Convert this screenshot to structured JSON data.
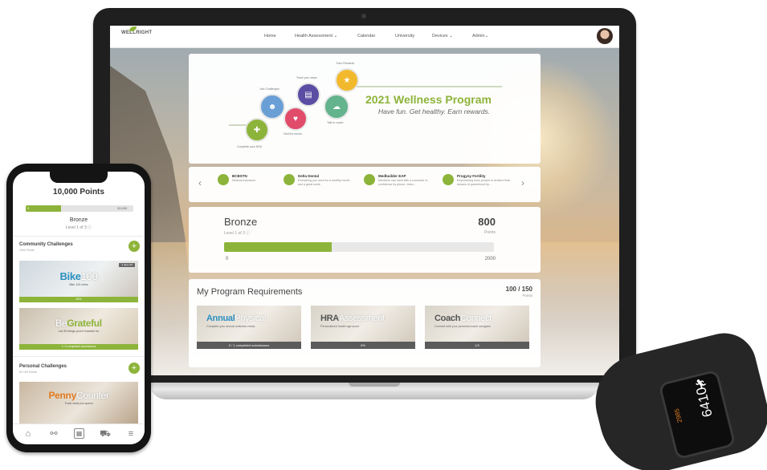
{
  "laptop": {
    "nav": {
      "logo": "WELLRIGHT",
      "items": [
        "Home",
        "Health Assessment ⌄",
        "Calendar",
        "University",
        "Devices ⌄",
        "Admin⌄"
      ]
    },
    "hero": {
      "title": "2021 Wellness Program",
      "subtitle": "Have fun. Get healthy. Earn rewards.",
      "steps": [
        "Complete your HRA",
        "Join Challenges",
        "Visit the doctor",
        "Track your steps",
        "Talk to coach",
        "Earn Rewards"
      ]
    },
    "partners": [
      {
        "name": "BCBSTN",
        "desc": "Medical Insurance"
      },
      {
        "name": "Delta Dental",
        "desc": "Everything you need for a healthy mouth and a great smile."
      },
      {
        "name": "Medbuilder EAP",
        "desc": "Members can meet with a counselor in confidence by phone, video..."
      },
      {
        "name": "Progyny Fertility",
        "desc": "Empowering more people to achieve their dreams of parenthood by..."
      }
    ],
    "level": {
      "name": "Bronze",
      "sub": "Level 1 of 3 ⓘ",
      "points": "800",
      "points_unit": "Points",
      "progress": 0.4,
      "min": "0",
      "max": "2000"
    },
    "requirements": {
      "title": "My Program Requirements",
      "count": "100 / 150",
      "unit": "Points",
      "tiles": [
        {
          "bold": "Annual",
          "light": "Physical",
          "desc": "Complete your annual wellness check.",
          "foot": "0 / 1 completed submissions"
        },
        {
          "bold": "HRA",
          "light": "Assessment",
          "desc": "Personalized health age score",
          "foot": "0%"
        },
        {
          "bold": "Coach",
          "light": "Connect",
          "desc": "Connect with your personal coach navigator",
          "foot": "1/3"
        }
      ]
    }
  },
  "phone": {
    "points_title": "10,000 Points",
    "bar_min": "0",
    "bar_max": "30,000",
    "progress": 0.33,
    "level": "Bronze",
    "level_sub": "Level 1 of 3 ⓘ",
    "community": {
      "title": "Community Challenges",
      "sub": "1000 Points",
      "plus": "+"
    },
    "personal": {
      "title": "Personal Challenges",
      "sub": "50-100 Points",
      "plus": "+"
    },
    "tiles": [
      {
        "bold": "Bike",
        "light": "100",
        "desc": "Bike 100 miles",
        "foot": "50%",
        "tag": "3 days left"
      },
      {
        "bold": "Grateful",
        "light": "Be",
        "desc": "List 99 things you're thankful for",
        "foot": "1 / 6 completed submissions",
        "tag": ""
      },
      {
        "bold": "Penny",
        "light": "Counter",
        "desc": "Track what you spend",
        "foot": "",
        "tag": ""
      }
    ],
    "tabs": [
      "home-icon",
      "link-icon",
      "calendar-icon",
      "cart-icon",
      "menu-icon"
    ]
  },
  "band": {
    "steps": "6410",
    "kcal": "2985"
  },
  "colors": {
    "accent": "#8db43a",
    "blue": "#2b8fbf",
    "dark": "#1f1f1f"
  }
}
